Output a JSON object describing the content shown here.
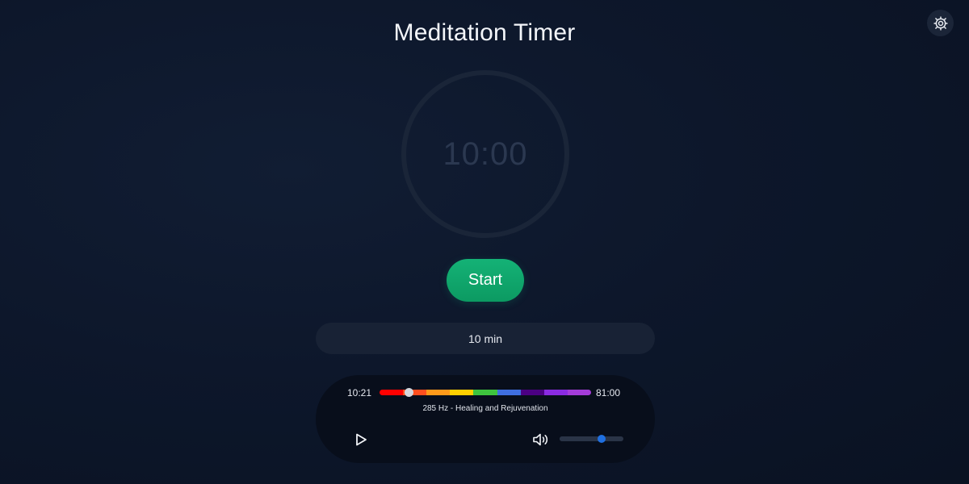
{
  "app": {
    "title": "Meditation Timer"
  },
  "timer": {
    "display": "10:00"
  },
  "controls": {
    "start_label": "Start",
    "duration_value": "10 min",
    "settings_icon": "gear-icon"
  },
  "player": {
    "current_time": "10:21",
    "total_time": "81:00",
    "track_name": "285 Hz - Healing and Rejuvenation",
    "progress_fraction": 0.14,
    "volume_fraction": 0.66,
    "play_icon": "play-icon",
    "volume_icon": "speaker-volume-icon",
    "spectrum_colors": [
      "#ff0000",
      "#ff4f1f",
      "#ff9a1a",
      "#ffd000",
      "#3ec43e",
      "#3f6fe0",
      "#4b0082",
      "#8a2be2",
      "#a43cd9"
    ]
  },
  "colors": {
    "accent_start": "#10a86d",
    "volume_thumb": "#1f6fe0",
    "timer_ring": "#1a2538"
  }
}
